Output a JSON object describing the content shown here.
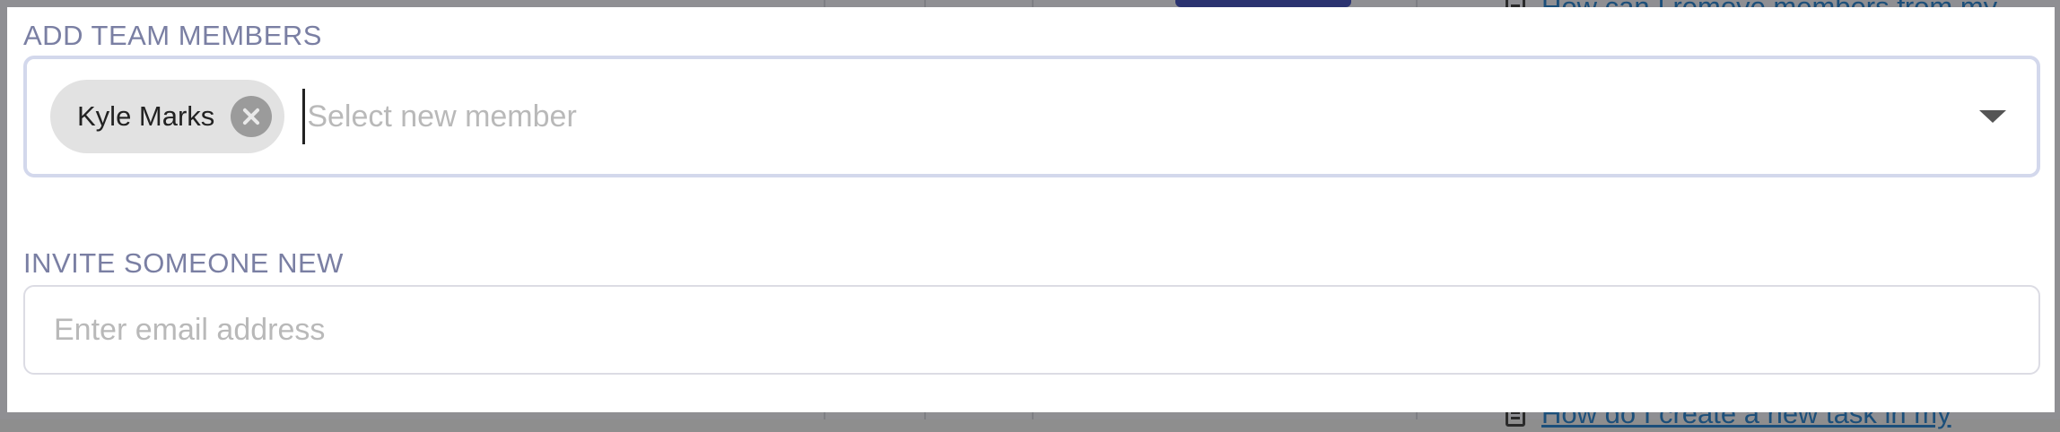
{
  "background": {
    "link_1": "How can I remove members from my",
    "link_2": "How do I create a new task in my"
  },
  "team": {
    "section_label": "ADD TEAM MEMBERS",
    "selected_member": "Kyle Marks",
    "select_placeholder": "Select new member"
  },
  "invite": {
    "section_label": "INVITE SOMEONE NEW",
    "email_placeholder": "Enter email address"
  },
  "colors": {
    "label": "#7a7fa3",
    "field_border_focused": "#d3d8ec",
    "chip_background": "#e2e2e2"
  }
}
